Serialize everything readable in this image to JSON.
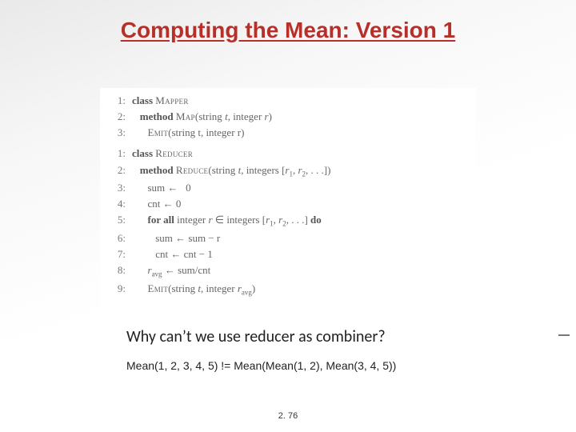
{
  "title": "Computing the Mean: Version 1",
  "mapper": {
    "l1_class": "class",
    "l1_name": "Mapper",
    "l2_method": "method",
    "l2_sig": "Map(string t, integer r)",
    "l3_emit": "Emit",
    "l3_args": "(string t, integer r)"
  },
  "reducer": {
    "l1_class": "class",
    "l1_name": "Reducer",
    "l2_method": "method",
    "l2_sig": "Reduce(string t, integers [r",
    "l2_sig_tail": ", r",
    "l2_sig_end": ", . . .])",
    "l3": "sum ←   0",
    "l4": "cnt ← 0",
    "l5_for": "for all",
    "l5_mid": " integer r ∈ integers [r",
    "l5_tail": ", r",
    "l5_end": ", . . .] ",
    "l5_do": "do",
    "l6": "sum ← sum − r",
    "l7": "cnt ← cnt − 1",
    "l8_var": "r",
    "l8_sub": "avg",
    "l8_rest": " ← sum/cnt",
    "l9_emit": "Emit",
    "l9_args": "(string t, integer r",
    "l9_sub": "avg",
    "l9_close": ")"
  },
  "question": "Why can’t we use reducer as combiner?",
  "example": "Mean(1, 2, 3, 4, 5) != Mean(Mean(1, 2), Mean(3, 4, 5))",
  "pagenum": "2. 76"
}
